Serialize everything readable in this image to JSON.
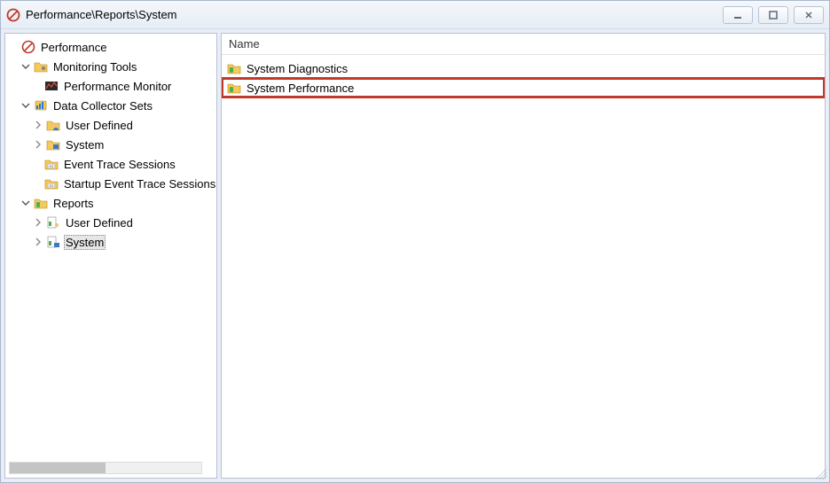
{
  "title": "Performance\\Reports\\System",
  "tree": {
    "root_label": "Performance",
    "monitoring_tools": "Monitoring Tools",
    "performance_monitor": "Performance Monitor",
    "data_collector_sets": "Data Collector Sets",
    "dcs_user_defined": "User Defined",
    "dcs_system": "System",
    "dcs_event_trace": "Event Trace Sessions",
    "dcs_startup_event_trace": "Startup Event Trace Sessions",
    "reports": "Reports",
    "reports_user_defined": "User Defined",
    "reports_system": "System"
  },
  "list": {
    "header_name": "Name",
    "items": [
      {
        "label": "System Diagnostics",
        "highlighted": false
      },
      {
        "label": "System Performance",
        "highlighted": true
      }
    ]
  }
}
